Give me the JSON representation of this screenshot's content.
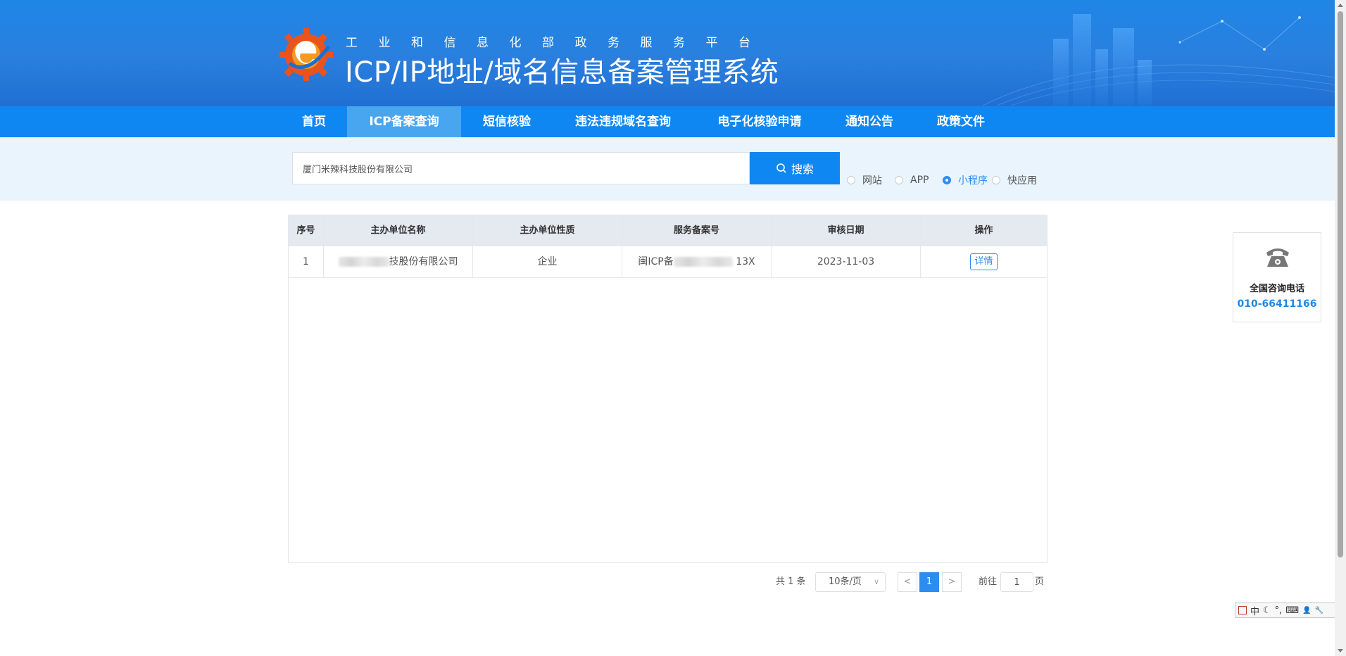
{
  "header": {
    "subtitle": "工业和信息化部政务服务平台",
    "title": "ICP/IP地址/域名信息备案管理系统"
  },
  "nav": {
    "items": [
      {
        "label": "首页",
        "active": false
      },
      {
        "label": "ICP备案查询",
        "active": true
      },
      {
        "label": "短信核验",
        "active": false
      },
      {
        "label": "违法违规域名查询",
        "active": false
      },
      {
        "label": "电子化核验申请",
        "active": false
      },
      {
        "label": "通知公告",
        "active": false
      },
      {
        "label": "政策文件",
        "active": false
      }
    ]
  },
  "search": {
    "value": "厦门米辣科技股份有限公司",
    "button_label": "搜索",
    "types": [
      {
        "label": "网站",
        "checked": false
      },
      {
        "label": "APP",
        "checked": false
      },
      {
        "label": "小程序",
        "checked": true
      },
      {
        "label": "快应用",
        "checked": false
      }
    ]
  },
  "table": {
    "columns": [
      "序号",
      "主办单位名称",
      "主办单位性质",
      "服务备案号",
      "审核日期",
      "操作"
    ],
    "rows": [
      {
        "index": "1",
        "unit_name_visible": "技股份有限公司",
        "unit_type": "企业",
        "record_prefix": "闽ICP备",
        "record_suffix": "13X",
        "date": "2023-11-03",
        "action": "详情"
      }
    ]
  },
  "pagination": {
    "total": "共 1 条",
    "page_size": "10条/页",
    "current_page": "1",
    "goto_label": "前往",
    "goto_value": "1",
    "goto_suffix": "页"
  },
  "contact": {
    "label": "全国咨询电话",
    "phone": "010-66411166"
  },
  "ime": {
    "items": [
      "中",
      "☾",
      "°,",
      "⌨",
      "👤",
      "🔧"
    ]
  }
}
